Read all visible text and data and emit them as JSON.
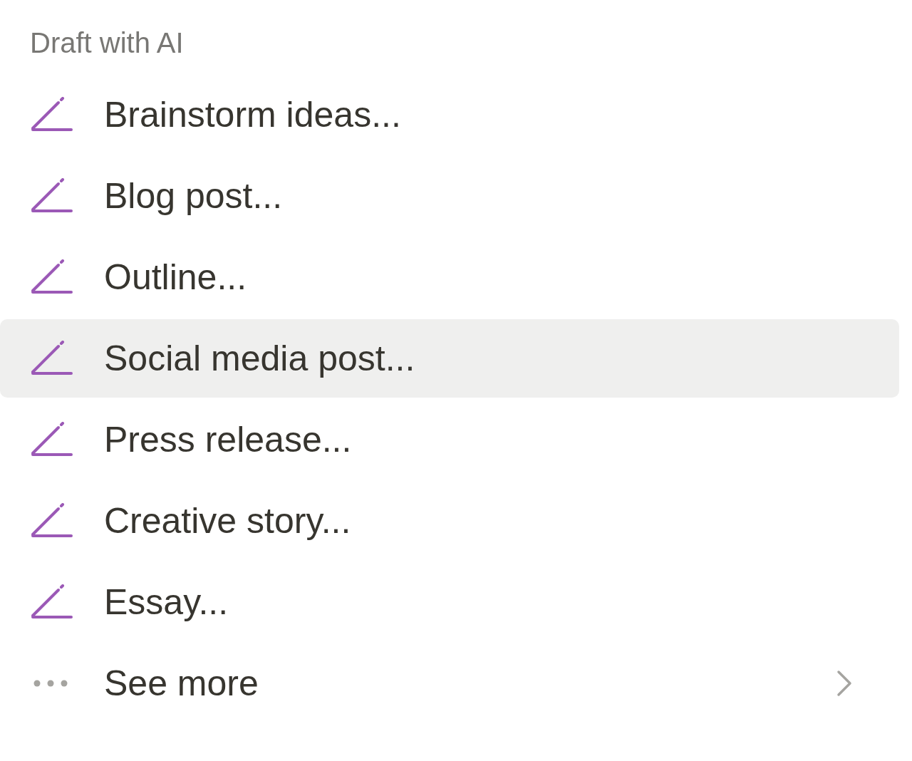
{
  "header": "Draft with AI",
  "items": [
    {
      "label": "Brainstorm ideas...",
      "kind": "draft",
      "selected": false
    },
    {
      "label": "Blog post...",
      "kind": "draft",
      "selected": false
    },
    {
      "label": "Outline...",
      "kind": "draft",
      "selected": false
    },
    {
      "label": "Social media post...",
      "kind": "draft",
      "selected": true
    },
    {
      "label": "Press release...",
      "kind": "draft",
      "selected": false
    },
    {
      "label": "Creative story...",
      "kind": "draft",
      "selected": false
    },
    {
      "label": "Essay...",
      "kind": "draft",
      "selected": false
    },
    {
      "label": "See more",
      "kind": "more",
      "selected": false
    }
  ]
}
